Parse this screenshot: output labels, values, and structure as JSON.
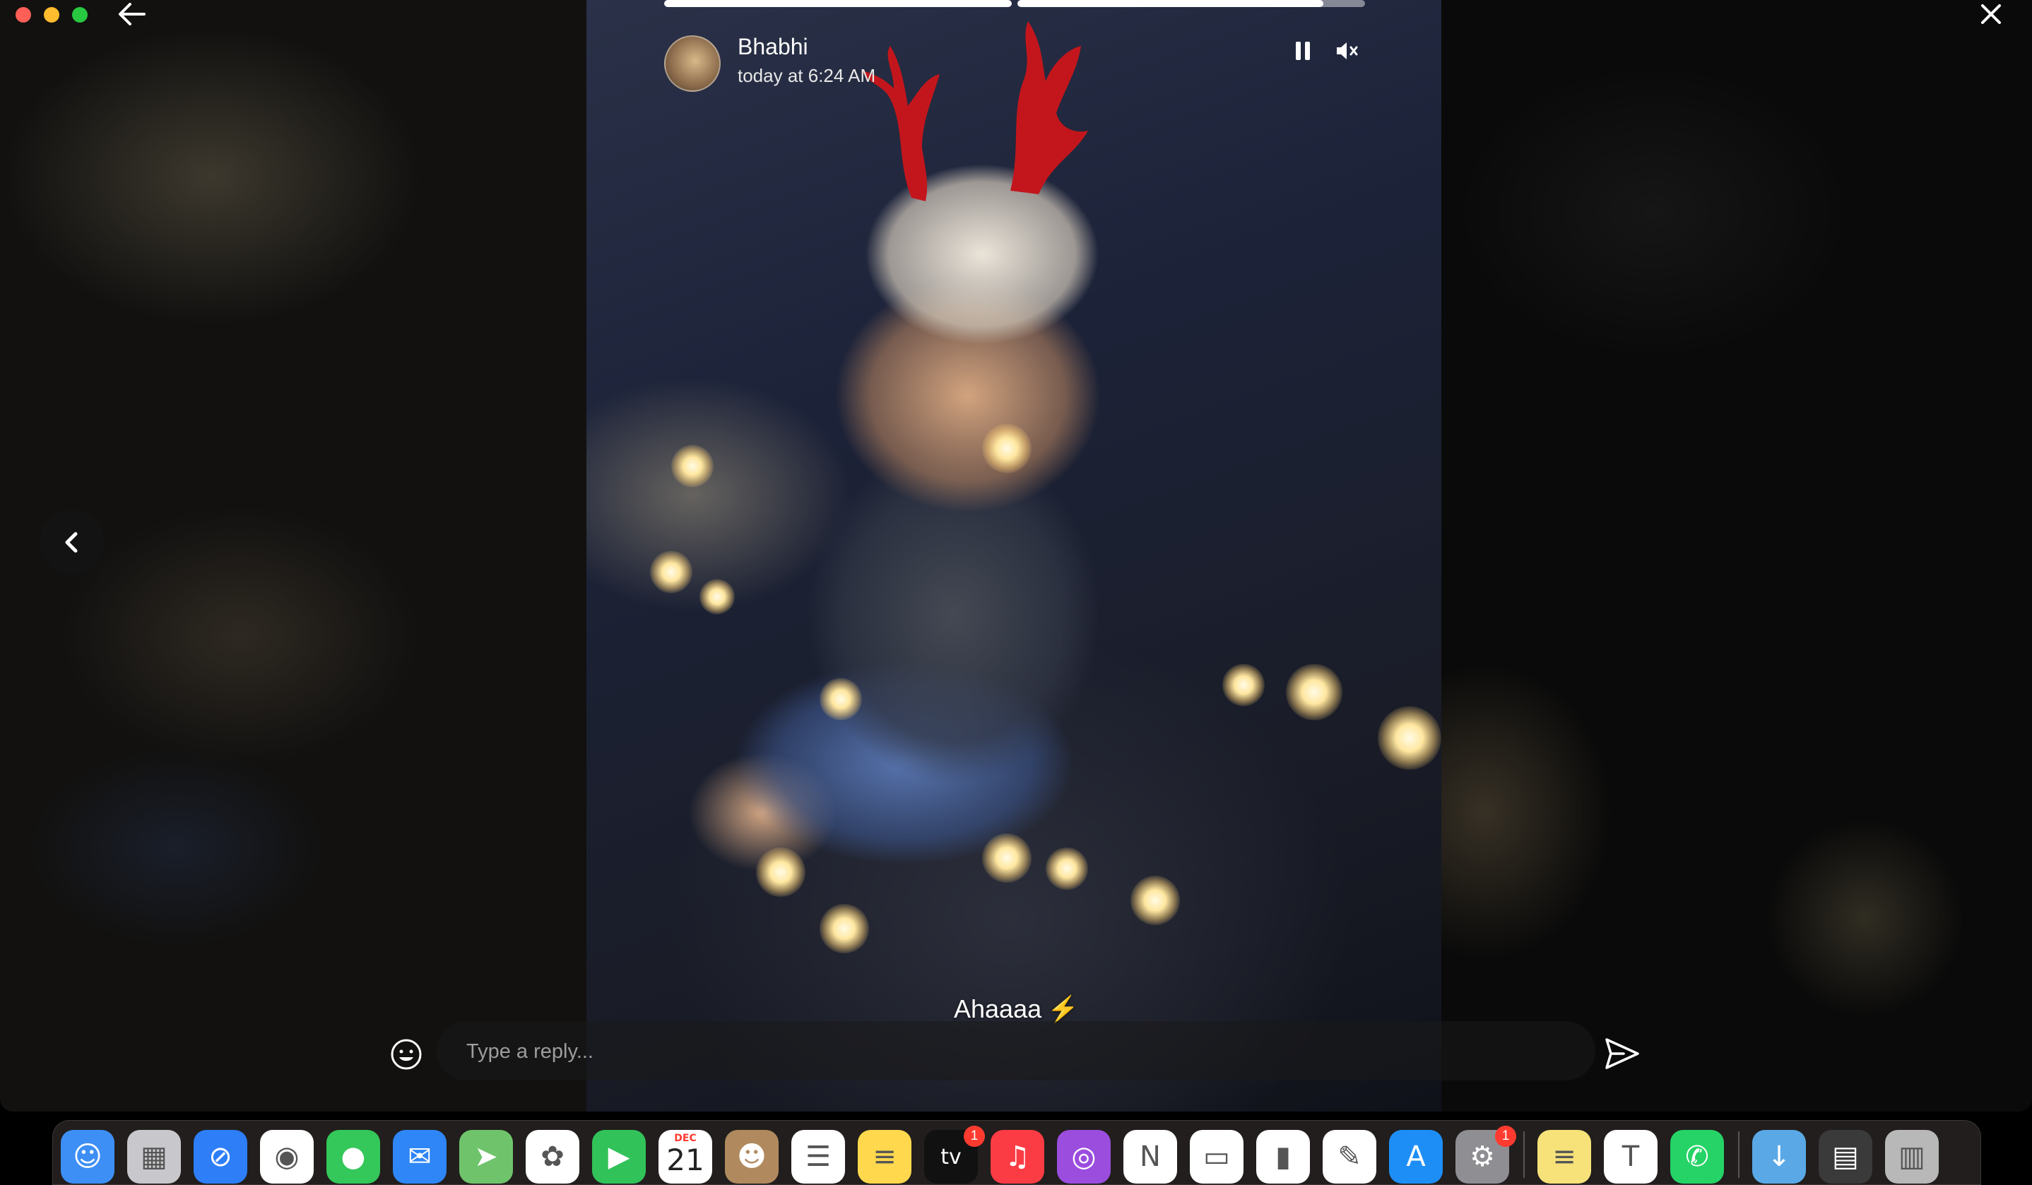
{
  "story": {
    "sender_name": "Bhabhi",
    "timestamp": "today at 6:24 AM",
    "caption": "Ahaaaa",
    "caption_emoji": "⚡",
    "progress": [
      1.0,
      0.88
    ]
  },
  "reply": {
    "placeholder": "Type a reply..."
  },
  "dock": {
    "apps": [
      {
        "name": "Finder",
        "icon": "finder-icon",
        "color": "#3d8ff5"
      },
      {
        "name": "Launchpad",
        "icon": "launchpad-icon",
        "color": "#c8c8cc"
      },
      {
        "name": "Safari",
        "icon": "safari-icon",
        "color": "#2d7ef7"
      },
      {
        "name": "Chrome",
        "icon": "chrome-icon",
        "color": "#ffffff"
      },
      {
        "name": "Messages",
        "icon": "messages-icon",
        "color": "#34c759"
      },
      {
        "name": "Mail",
        "icon": "mail-icon",
        "color": "#2f86f6"
      },
      {
        "name": "Maps",
        "icon": "maps-icon",
        "color": "#6fc46b"
      },
      {
        "name": "Photos",
        "icon": "photos-icon",
        "color": "#ffffff"
      },
      {
        "name": "FaceTime",
        "icon": "facetime-icon",
        "color": "#32c25a"
      },
      {
        "name": "Calendar",
        "icon": "calendar-icon",
        "color": "#ffffff",
        "month": "DEC",
        "day": "21"
      },
      {
        "name": "Contacts",
        "icon": "contacts-icon",
        "color": "#b08a5e"
      },
      {
        "name": "Reminders",
        "icon": "reminders-icon",
        "color": "#ffffff"
      },
      {
        "name": "Notes",
        "icon": "notes-icon",
        "color": "#ffd84d"
      },
      {
        "name": "TV",
        "icon": "tv-icon",
        "color": "#111111",
        "label": "tv",
        "badge": "1"
      },
      {
        "name": "Music",
        "icon": "music-icon",
        "color": "#fc3c44"
      },
      {
        "name": "Podcasts",
        "icon": "podcasts-icon",
        "color": "#9b4dde"
      },
      {
        "name": "News",
        "icon": "news-icon",
        "color": "#ffffff"
      },
      {
        "name": "Keynote",
        "icon": "keynote-icon",
        "color": "#ffffff"
      },
      {
        "name": "Numbers",
        "icon": "numbers-icon",
        "color": "#ffffff"
      },
      {
        "name": "Pages",
        "icon": "pages-icon",
        "color": "#ffffff"
      },
      {
        "name": "App Store",
        "icon": "app-store-icon",
        "color": "#1e8ef7"
      },
      {
        "name": "System Settings",
        "icon": "settings-icon",
        "color": "#8e8e93",
        "badge": "1"
      },
      {
        "name": "Stickies",
        "icon": "stickies-icon",
        "color": "#f7e27a"
      },
      {
        "name": "Teams",
        "icon": "teams-icon",
        "color": "#ffffff"
      },
      {
        "name": "WhatsApp",
        "icon": "whatsapp-icon",
        "color": "#25d366"
      },
      {
        "name": "Downloads",
        "icon": "downloads-folder-icon",
        "color": "#5aa9e6"
      },
      {
        "name": "Screenshots",
        "icon": "screenshots-stack-icon",
        "color": "#3a3a3a"
      },
      {
        "name": "Trash",
        "icon": "trash-icon",
        "color": "#b8b8b8"
      }
    ]
  }
}
